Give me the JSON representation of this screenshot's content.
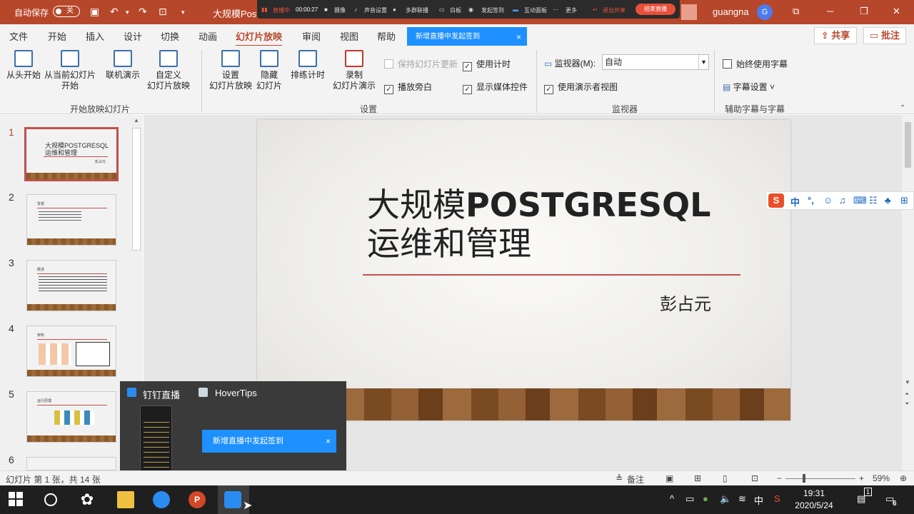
{
  "titlebar": {
    "autosave_label": "自动保存",
    "autosave_state": "关",
    "doc_title": "大规模Post",
    "user_name": "guangna",
    "avatar_initial": "G"
  },
  "livebar": {
    "status": "直播中",
    "timer": "00:00:27",
    "camera": "摄像",
    "audio": "声音设置",
    "participants": "多群联播",
    "whiteboard": "白板",
    "signin": "发起签到",
    "interact": "互动面板",
    "more": "更多",
    "exit_share": "退出共享",
    "end_live": "结束直播"
  },
  "menu": {
    "items": [
      "文件",
      "开始",
      "插入",
      "设计",
      "切换",
      "动画",
      "幻灯片放映",
      "审阅",
      "视图",
      "帮助"
    ],
    "share": "共享",
    "comment": "批注"
  },
  "toast_top": "新增直播中发起签到",
  "ribbon": {
    "from_start": "从头开始",
    "from_current_1": "从当前幻灯片",
    "from_current_2": "开始",
    "online_1": "联机演示",
    "custom_1": "自定义",
    "custom_2": "幻灯片放映",
    "group_start": "开始放映幻灯片",
    "setup_1": "设置",
    "setup_2": "幻灯片放映",
    "hide_1": "隐藏",
    "hide_2": "幻灯片",
    "rehearse": "排练计时",
    "record_1": "录制",
    "record_2": "幻灯片演示",
    "keep_updated": "保持幻灯片更新",
    "use_timings": "使用计时",
    "play_narration": "播放旁白",
    "show_media": "显示媒体控件",
    "group_setup": "设置",
    "monitor_label": "监视器(M):",
    "monitor_value": "自动",
    "presenter_view": "使用演示者视图",
    "group_monitor": "监视器",
    "always_subtitles": "始终使用字幕",
    "subtitle_settings": "字幕设置",
    "group_captions": "辅助字幕与字幕"
  },
  "slides": {
    "numbers": [
      "1",
      "2",
      "3",
      "4",
      "5",
      "6"
    ],
    "thumb1_title": "大规模POSTGRESQL",
    "thumb1_sub": "运维和管理",
    "thumb1_author": "彭占元",
    "thumb2_title": "背景",
    "thumb3_title": "概述",
    "thumb4_title": "架构",
    "thumb5_title": "运行原理"
  },
  "slide": {
    "title_line1_cn": "大规模",
    "title_line1_en": "POSTGRESQL",
    "title_line2": "运维和管理",
    "author": "彭占元"
  },
  "ime": {
    "logo": "S",
    "mode": "中",
    "punct": "°,"
  },
  "taskpop": {
    "app1": "钉钉直播",
    "app2": "HoverTips"
  },
  "toast_bottom": "新增直播中发起签到",
  "status": {
    "slide_info": "幻灯片 第 1 张，共 14 张",
    "notes": "备注",
    "zoom": "59%"
  },
  "taskbar": {
    "time": "19:31",
    "date": "2020/5/24",
    "ime_mode": "中",
    "notif_count": "6",
    "badge": "1"
  }
}
